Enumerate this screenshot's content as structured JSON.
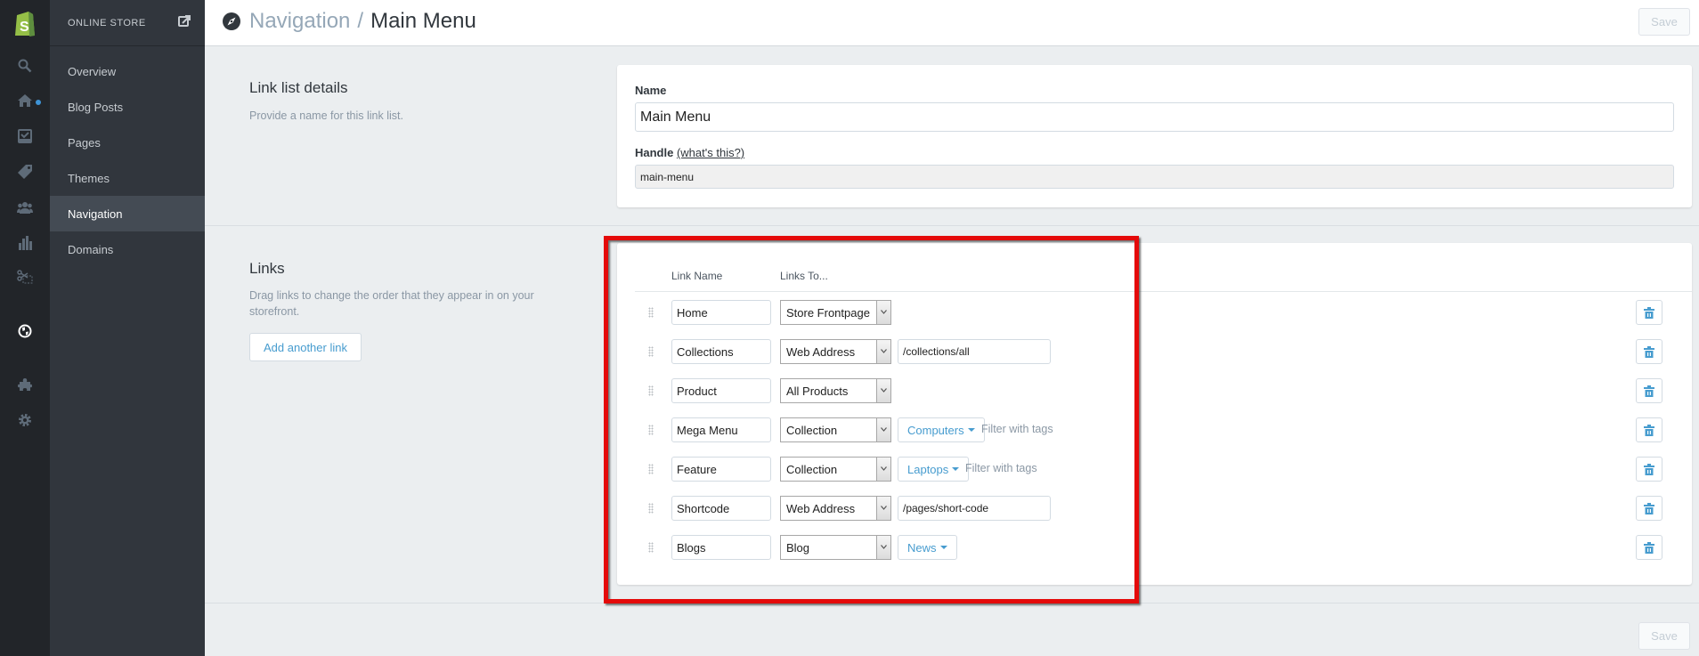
{
  "rail": {
    "icons": [
      "shopify-logo-icon",
      "search-icon",
      "home-icon",
      "orders-icon",
      "products-tag-icon",
      "customers-icon",
      "reports-icon",
      "discounts-icon",
      "online-store-globe-icon",
      "apps-icon",
      "settings-icon"
    ]
  },
  "subnav": {
    "title": "ONLINE STORE",
    "items": [
      {
        "label": "Overview",
        "active": false
      },
      {
        "label": "Blog Posts",
        "active": false
      },
      {
        "label": "Pages",
        "active": false
      },
      {
        "label": "Themes",
        "active": false
      },
      {
        "label": "Navigation",
        "active": true
      },
      {
        "label": "Domains",
        "active": false
      }
    ]
  },
  "header": {
    "parent": "Navigation",
    "separator": "/",
    "current": "Main Menu",
    "save_label": "Save"
  },
  "details": {
    "title": "Link list details",
    "description": "Provide a name for this link list.",
    "name_label": "Name",
    "name_value": "Main Menu",
    "handle_label": "Handle",
    "handle_help": "(what's this?)",
    "handle_value": "main-menu"
  },
  "links": {
    "title": "Links",
    "description": "Drag links to change the order that they appear in on your storefront.",
    "add_label": "Add another link",
    "col_name": "Link Name",
    "col_to": "Links To...",
    "rows": [
      {
        "name": "Home",
        "type": "Store Frontpage",
        "url": null,
        "target": null,
        "filter": null
      },
      {
        "name": "Collections",
        "type": "Web Address",
        "url": "/collections/all",
        "target": null,
        "filter": null
      },
      {
        "name": "Product",
        "type": "All Products",
        "url": null,
        "target": null,
        "filter": null
      },
      {
        "name": "Mega Menu",
        "type": "Collection",
        "url": null,
        "target": "Computers",
        "filter": "Filter with tags"
      },
      {
        "name": "Feature",
        "type": "Collection",
        "url": null,
        "target": "Laptops",
        "filter": "Filter with tags"
      },
      {
        "name": "Shortcode",
        "type": "Web Address",
        "url": "/pages/short-code",
        "target": null,
        "filter": null
      },
      {
        "name": "Blogs",
        "type": "Blog",
        "url": null,
        "target": "News",
        "filter": null
      }
    ]
  },
  "footer": {
    "save_label": "Save"
  },
  "colors": {
    "accent": "#479ccf",
    "highlight": "#e40a0a",
    "sidebar": "#31363d",
    "rail": "#222529"
  }
}
